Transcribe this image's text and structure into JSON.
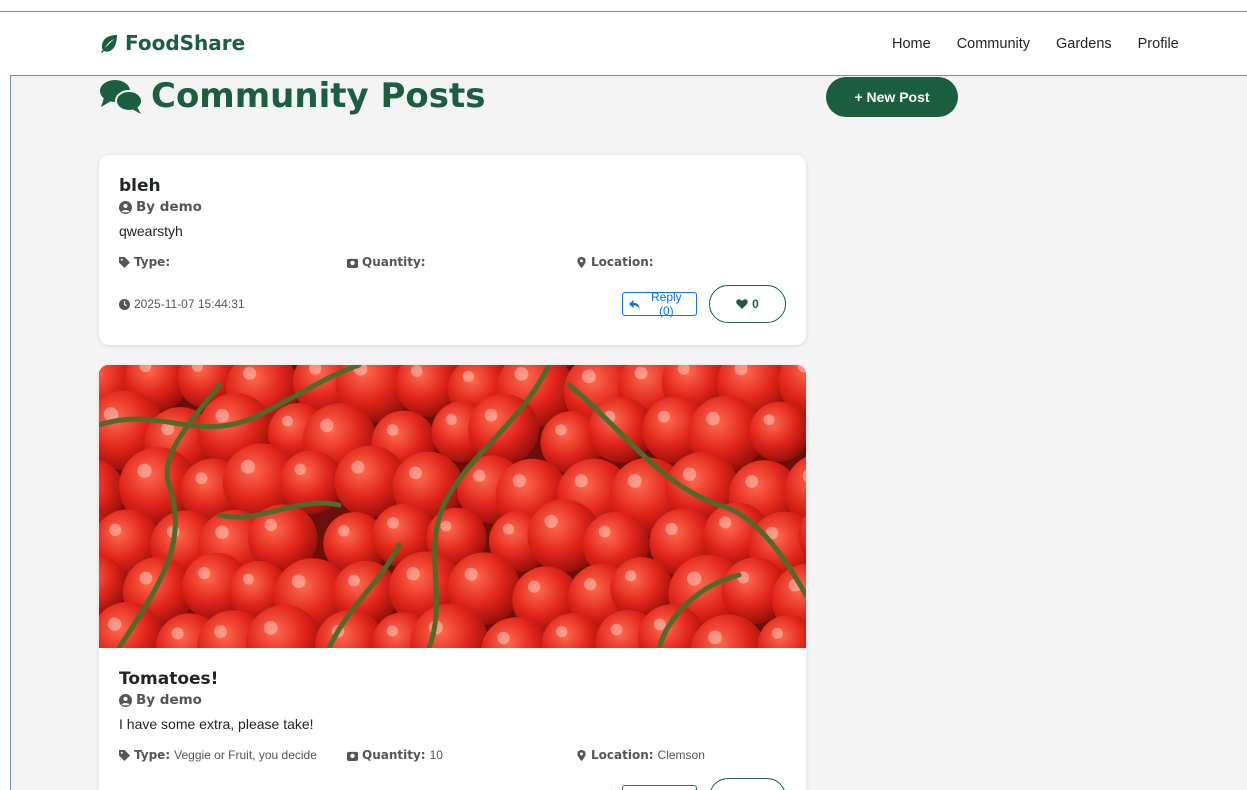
{
  "navbar": {
    "brand": "FoodShare",
    "links": [
      "Home",
      "Community",
      "Gardens",
      "Profile"
    ]
  },
  "page": {
    "title": "Community Posts",
    "new_post_label": "+ New Post"
  },
  "labels": {
    "type": "Type:",
    "quantity": "Quantity:",
    "location": "Location:"
  },
  "posts": [
    {
      "title": "bleh",
      "author": "By demo",
      "content": "qwearstyh",
      "type": "",
      "quantity": "",
      "location": "",
      "timestamp": "2025-11-07 15:44:31",
      "reply_label": "Reply (0)",
      "likes": "0",
      "has_image": false
    },
    {
      "title": "Tomatoes!",
      "author": "By demo",
      "content": "I have some extra, please take!",
      "type": "Veggie or Fruit, you decide",
      "quantity": "10",
      "location": "Clemson",
      "has_image": true,
      "image_alt": "tomatoes-photo"
    }
  ],
  "colors": {
    "brand": "#1b5e40",
    "background": "#f4f4f4",
    "reply": "#0d6efd"
  }
}
